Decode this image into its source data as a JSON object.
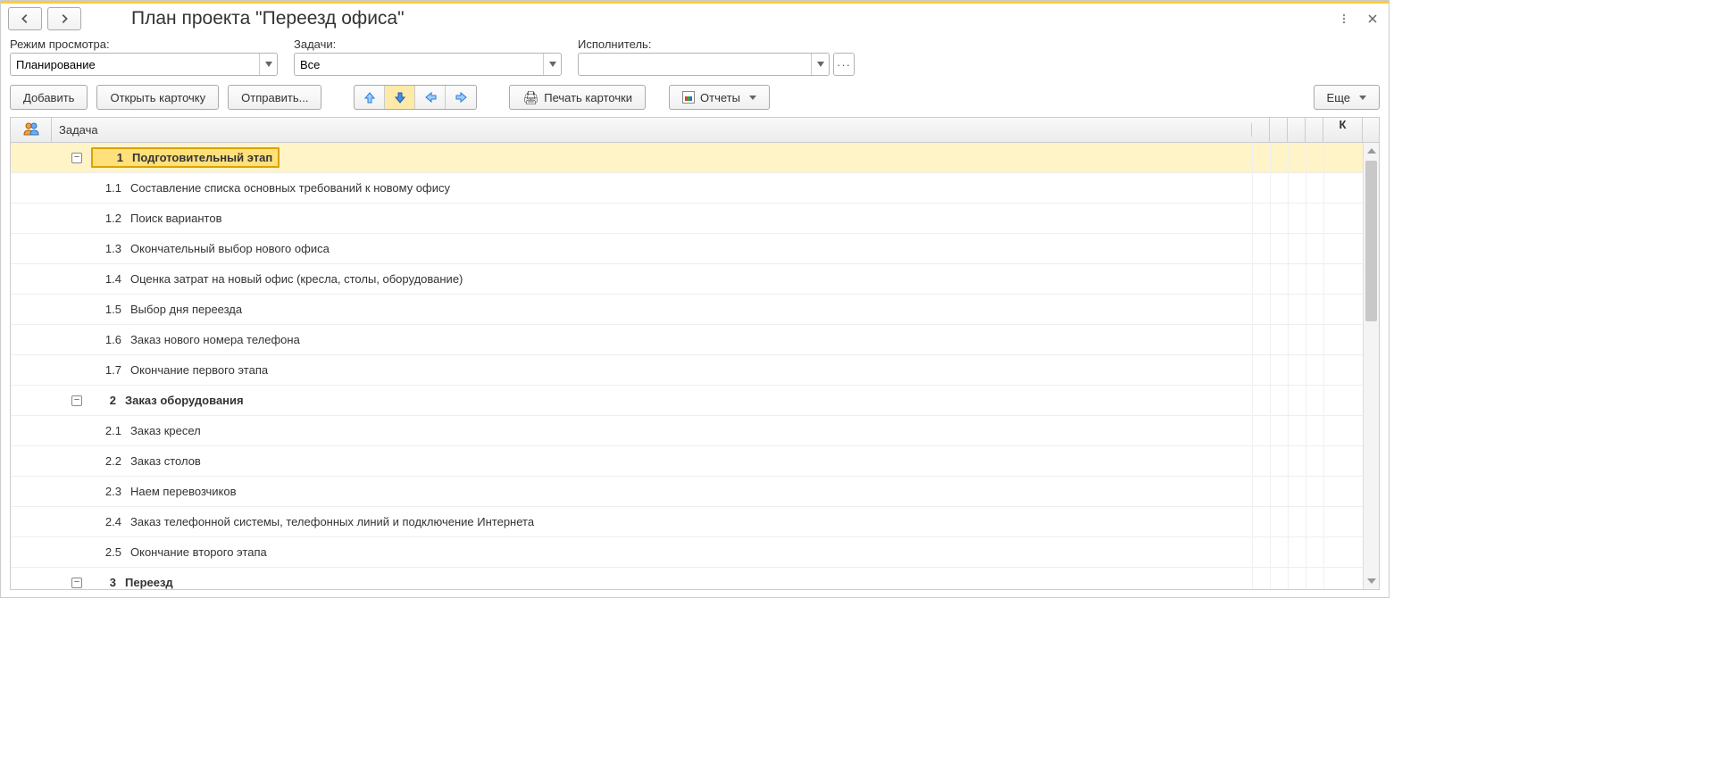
{
  "title": "План проекта \"Переезд офиса\"",
  "filters": {
    "view_mode": {
      "label": "Режим просмотра:",
      "value": "Планирование"
    },
    "tasks": {
      "label": "Задачи:",
      "value": "Все"
    },
    "assignee": {
      "label": "Исполнитель:",
      "value": ""
    }
  },
  "toolbar": {
    "add": "Добавить",
    "open_card": "Открыть карточку",
    "send": "Отправить...",
    "print_card": "Печать карточки",
    "reports": "Отчеты",
    "more": "Еще"
  },
  "table": {
    "header_task": "Задача",
    "header_k": "К",
    "rows": [
      {
        "level": 1,
        "num": "1",
        "text": "Подготовительный этап",
        "group": true,
        "expanded": true,
        "selected": true
      },
      {
        "level": 2,
        "num": "1.1",
        "text": "Составление списка основных требований к новому офису"
      },
      {
        "level": 2,
        "num": "1.2",
        "text": "Поиск вариантов"
      },
      {
        "level": 2,
        "num": "1.3",
        "text": "Окончательный выбор нового офиса"
      },
      {
        "level": 2,
        "num": "1.4",
        "text": "Оценка затрат на новый офис (кресла, столы, оборудование)"
      },
      {
        "level": 2,
        "num": "1.5",
        "text": "Выбор дня переезда"
      },
      {
        "level": 2,
        "num": "1.6",
        "text": "Заказ нового номера телефона"
      },
      {
        "level": 2,
        "num": "1.7",
        "text": "Окончание первого этапа"
      },
      {
        "level": 1,
        "num": "2",
        "text": "Заказ оборудования",
        "group": true,
        "expanded": true
      },
      {
        "level": 2,
        "num": "2.1",
        "text": "Заказ кресел"
      },
      {
        "level": 2,
        "num": "2.2",
        "text": "Заказ столов"
      },
      {
        "level": 2,
        "num": "2.3",
        "text": "Наем перевозчиков"
      },
      {
        "level": 2,
        "num": "2.4",
        "text": "Заказ телефонной системы, телефонных линий и подключение Интернета"
      },
      {
        "level": 2,
        "num": "2.5",
        "text": "Окончание второго этапа"
      },
      {
        "level": 1,
        "num": "3",
        "text": "Переезд",
        "group": true,
        "expanded": true
      }
    ]
  }
}
